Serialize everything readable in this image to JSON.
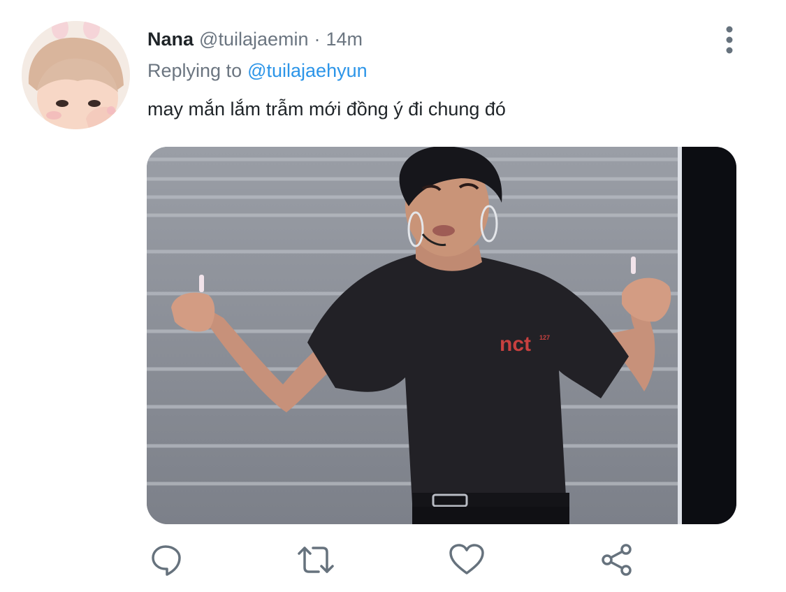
{
  "tweet": {
    "display_name": "Nana",
    "handle": "@tuilajaemin",
    "separator": "·",
    "time": "14m",
    "reply_prefix": "Replying to",
    "reply_handle": "@tuilajaehyun",
    "text": "may mắn lắm trẫm mới đồng ý đi chung đó"
  },
  "icons": {
    "avatar": "avatar-photo",
    "more": "more-vertical-icon",
    "reply": "reply-icon",
    "retweet": "retweet-icon",
    "like": "heart-icon",
    "share": "share-icon"
  },
  "media": {
    "shirt_text": "nct",
    "shirt_superscript": "127"
  },
  "colors": {
    "link": "#2c95e8",
    "secondary_text": "#6b7580",
    "primary_text": "#1f2428",
    "icon": "#66727d"
  }
}
